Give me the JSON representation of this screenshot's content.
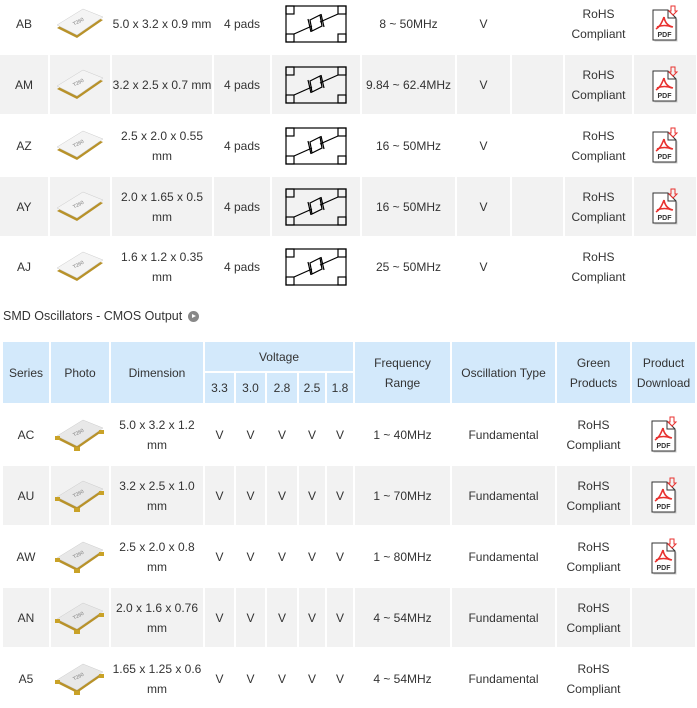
{
  "crystals": {
    "rows": [
      {
        "series": "AB",
        "dimension": "5.0 x 3.2 x 0.9 mm",
        "pads": "4 pads",
        "frequency": "8 ~ 50MHz",
        "v": "V",
        "green": "RoHS Compliant",
        "pdf": true
      },
      {
        "series": "AM",
        "dimension": "3.2 x 2.5 x 0.7 mm",
        "pads": "4 pads",
        "frequency": "9.84 ~ 62.4MHz",
        "v": "V",
        "green": "RoHS Compliant",
        "pdf": true
      },
      {
        "series": "AZ",
        "dimension": "2.5 x 2.0 x 0.55 mm",
        "pads": "4 pads",
        "frequency": "16 ~ 50MHz",
        "v": "V",
        "green": "RoHS Compliant",
        "pdf": true
      },
      {
        "series": "AY",
        "dimension": "2.0 x 1.65 x 0.5 mm",
        "pads": "4 pads",
        "frequency": "16 ~ 50MHz",
        "v": "V",
        "green": "RoHS Compliant",
        "pdf": true
      },
      {
        "series": "AJ",
        "dimension": "1.6 x 1.2 x 0.35 mm",
        "pads": "4 pads",
        "frequency": "25 ~ 50MHz",
        "v": "V",
        "green": "RoHS Compliant",
        "pdf": false
      }
    ]
  },
  "oscillators": {
    "title": "SMD Oscillators - CMOS Output",
    "headers": {
      "series": "Series",
      "photo": "Photo",
      "dimension": "Dimension",
      "voltage": "Voltage",
      "voltages": [
        "3.3",
        "3.0",
        "2.8",
        "2.5",
        "1.8"
      ],
      "frequency": "Frequency Range",
      "oscillation": "Oscillation Type",
      "green": "Green Products",
      "download": "Product Download"
    },
    "rows": [
      {
        "series": "AC",
        "dimension": "5.0 x 3.2 x 1.2 mm",
        "v": [
          "V",
          "V",
          "V",
          "V",
          "V"
        ],
        "frequency": "1 ~ 40MHz",
        "oscillation": "Fundamental",
        "green": "RoHS Compliant",
        "pdf": true
      },
      {
        "series": "AU",
        "dimension": "3.2 x 2.5 x 1.0 mm",
        "v": [
          "V",
          "V",
          "V",
          "V",
          "V"
        ],
        "frequency": "1 ~ 70MHz",
        "oscillation": "Fundamental",
        "green": "RoHS Compliant",
        "pdf": true
      },
      {
        "series": "AW",
        "dimension": "2.5 x 2.0 x 0.8 mm",
        "v": [
          "V",
          "V",
          "V",
          "V",
          "V"
        ],
        "frequency": "1 ~ 80MHz",
        "oscillation": "Fundamental",
        "green": "RoHS Compliant",
        "pdf": true
      },
      {
        "series": "AN",
        "dimension": "2.0 x 1.6 x 0.76 mm",
        "v": [
          "V",
          "V",
          "V",
          "V",
          "V"
        ],
        "frequency": "4 ~ 54MHz",
        "oscillation": "Fundamental",
        "green": "RoHS Compliant",
        "pdf": false
      },
      {
        "series": "A5",
        "dimension": "1.65 x 1.25 x 0.6 mm",
        "v": [
          "V",
          "V",
          "V",
          "V",
          "V"
        ],
        "frequency": "4 ~ 54MHz",
        "oscillation": "Fundamental",
        "green": "RoHS Compliant",
        "pdf": false
      }
    ]
  },
  "colors": {
    "header_bg": "#d3e9fb",
    "row_alt": "#f2f2f2",
    "pdf_red": "#e8312f"
  }
}
